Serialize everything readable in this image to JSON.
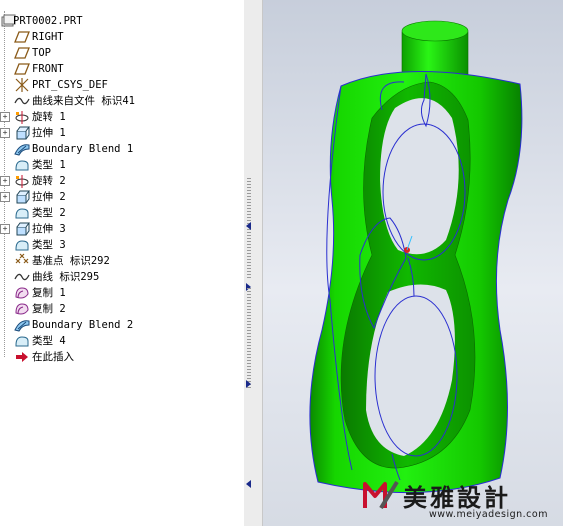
{
  "model_tree": {
    "root": {
      "label": "PRT0002.PRT",
      "icon": "part-icon"
    },
    "items": [
      {
        "label": "RIGHT",
        "icon": "datum-plane-icon",
        "expandable": false
      },
      {
        "label": "TOP",
        "icon": "datum-plane-icon",
        "expandable": false
      },
      {
        "label": "FRONT",
        "icon": "datum-plane-icon",
        "expandable": false
      },
      {
        "label": "PRT_CSYS_DEF",
        "icon": "coordinate-system-icon",
        "expandable": false
      },
      {
        "label": "曲线来自文件 标识41",
        "icon": "curve-icon",
        "expandable": false
      },
      {
        "label": "旋转 1",
        "icon": "revolve-icon",
        "expandable": true
      },
      {
        "label": "拉伸 1",
        "icon": "extrude-icon",
        "expandable": true
      },
      {
        "label": "Boundary Blend 1",
        "icon": "boundary-blend-icon",
        "expandable": false
      },
      {
        "label": "类型 1",
        "icon": "style-icon",
        "expandable": false
      },
      {
        "label": "旋转 2",
        "icon": "revolve-icon",
        "expandable": true
      },
      {
        "label": "拉伸 2",
        "icon": "extrude-icon",
        "expandable": true
      },
      {
        "label": "类型 2",
        "icon": "style-icon",
        "expandable": false
      },
      {
        "label": "拉伸 3",
        "icon": "extrude-icon",
        "expandable": true
      },
      {
        "label": "类型 3",
        "icon": "style-icon",
        "expandable": false
      },
      {
        "label": "基准点 标识292",
        "icon": "datum-point-icon",
        "expandable": false
      },
      {
        "label": "曲线 标识295",
        "icon": "curve-icon",
        "expandable": false
      },
      {
        "label": "复制 1",
        "icon": "copy-icon",
        "expandable": false
      },
      {
        "label": "复制 2",
        "icon": "copy-icon",
        "expandable": false
      },
      {
        "label": "Boundary Blend 2",
        "icon": "boundary-blend-icon",
        "expandable": false
      },
      {
        "label": "类型 4",
        "icon": "style-icon",
        "expandable": false
      },
      {
        "label": "在此插入",
        "icon": "insert-here-arrow-icon",
        "expandable": false
      }
    ]
  },
  "watermark": {
    "brand": "美雅設計",
    "url": "www.meiyadesign.com"
  },
  "colors": {
    "model_green": "#12d400",
    "edge_blue": "#2a2fd0",
    "insert_arrow": "#c8102e",
    "logo_red": "#c8102e"
  }
}
